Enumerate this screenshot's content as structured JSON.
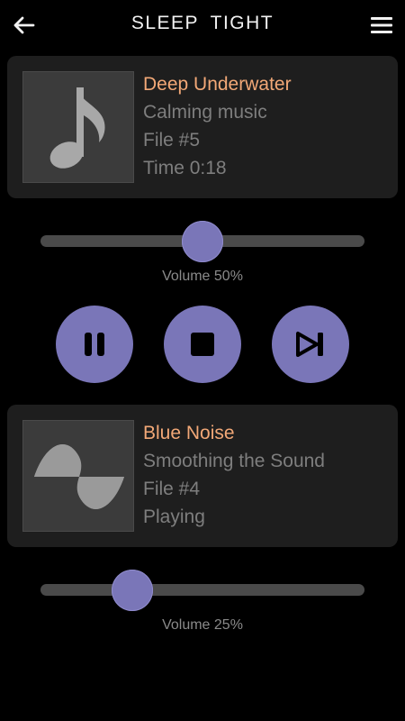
{
  "header": {
    "title": "SLEEP TIGHT",
    "back_icon": "arrow-left-icon",
    "menu_icon": "hamburger-menu-icon"
  },
  "track1": {
    "title": "Deep Underwater",
    "subtitle": "Calming music",
    "file": "File #5",
    "status": "Time 0:18",
    "art_icon": "music-note-icon"
  },
  "volume1": {
    "label": "Volume 50%",
    "value": 0.5
  },
  "controls": {
    "pause_icon": "pause-icon",
    "stop_icon": "stop-icon",
    "next_icon": "skip-next-icon"
  },
  "track2": {
    "title": "Blue Noise",
    "subtitle": "Smoothing the Sound",
    "file": "File #4",
    "status": "Playing",
    "art_icon": "sine-wave-icon"
  },
  "volume2": {
    "label": "Volume 25%",
    "value": 0.25
  },
  "colors": {
    "accent": "#7a76b8",
    "title_text": "#f2a877",
    "card_background": "#1e1e1e",
    "secondary_text": "#7e7e7e"
  }
}
